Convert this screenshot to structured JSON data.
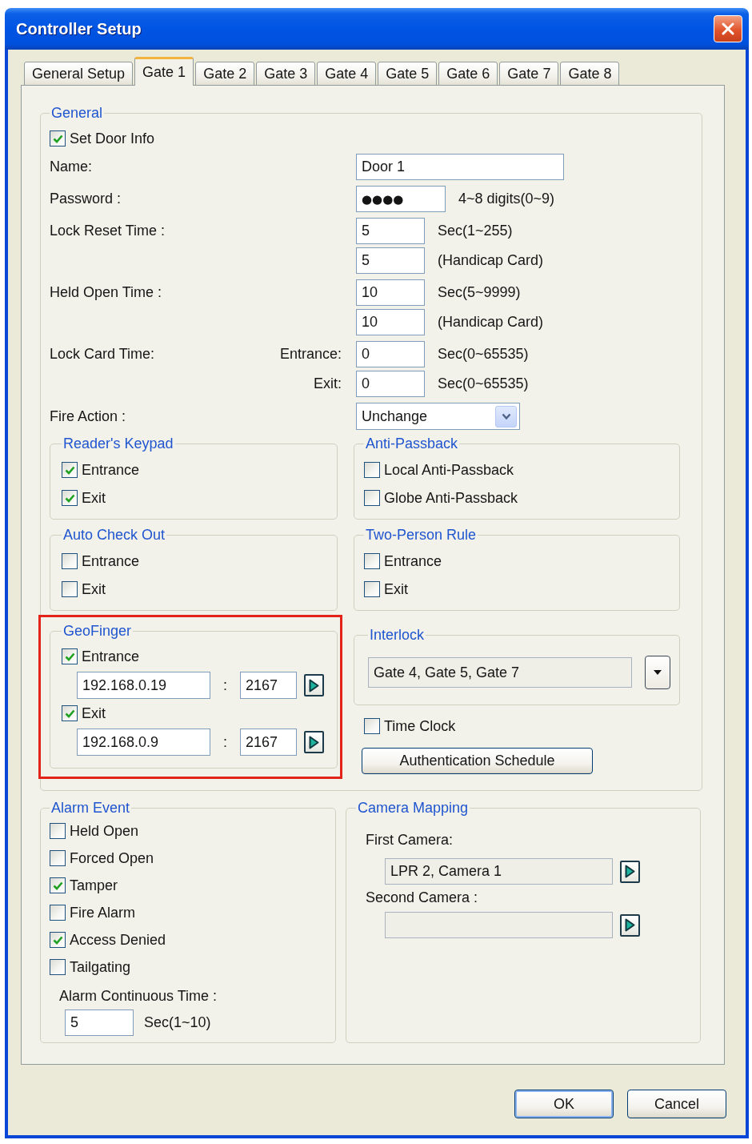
{
  "window": {
    "title": "Controller Setup"
  },
  "tabs": [
    {
      "label": "General Setup",
      "selected": false
    },
    {
      "label": "Gate 1",
      "selected": true
    },
    {
      "label": "Gate 2",
      "selected": false
    },
    {
      "label": "Gate 3",
      "selected": false
    },
    {
      "label": "Gate 4",
      "selected": false
    },
    {
      "label": "Gate 5",
      "selected": false
    },
    {
      "label": "Gate 6",
      "selected": false
    },
    {
      "label": "Gate 7",
      "selected": false
    },
    {
      "label": "Gate 8",
      "selected": false
    }
  ],
  "general": {
    "legend": "General",
    "set_door_info": {
      "label": "Set Door Info",
      "checked": true
    },
    "fields": [
      {
        "kind": "text",
        "label": "Name:",
        "lines": [
          {
            "value": "Door 1"
          }
        ]
      },
      {
        "kind": "password",
        "label": "Password :",
        "lines": [
          {
            "value": "●●●●",
            "hint": "4~8 digits(0~9)"
          }
        ]
      },
      {
        "kind": "number",
        "label": "Lock Reset Time :",
        "lines": [
          {
            "value": "5",
            "hint": "Sec(1~255)"
          },
          {
            "value": "5",
            "hint": "(Handicap Card)"
          }
        ]
      },
      {
        "kind": "number",
        "label": "Held Open Time :",
        "lines": [
          {
            "value": "10",
            "hint": "Sec(5~9999)"
          },
          {
            "value": "10",
            "hint": "(Handicap Card)"
          }
        ]
      },
      {
        "kind": "number",
        "label": "Lock Card Time:",
        "lines": [
          {
            "sublabel": "Entrance:",
            "value": "0",
            "hint": "Sec(0~65535)"
          },
          {
            "sublabel": "Exit:",
            "value": "0",
            "hint": "Sec(0~65535)"
          }
        ]
      },
      {
        "kind": "select",
        "label": "Fire Action :",
        "lines": [
          {
            "value": "Unchange"
          }
        ]
      }
    ],
    "sections": [
      {
        "kind": "checks",
        "legend": "Reader's Keypad",
        "highlighted": false,
        "items": [
          {
            "label": "Entrance",
            "checked": true
          },
          {
            "label": "Exit",
            "checked": true
          }
        ]
      },
      {
        "kind": "checks",
        "legend": "Anti-Passback",
        "highlighted": false,
        "items": [
          {
            "label": "Local Anti-Passback",
            "checked": false
          },
          {
            "label": "Globe Anti-Passback",
            "checked": false
          }
        ]
      },
      {
        "kind": "checks",
        "legend": "Auto Check Out",
        "highlighted": false,
        "items": [
          {
            "label": "Entrance",
            "checked": false
          },
          {
            "label": "Exit",
            "checked": false
          }
        ]
      },
      {
        "kind": "checks",
        "legend": "Two-Person Rule",
        "highlighted": false,
        "items": [
          {
            "label": "Entrance",
            "checked": false
          },
          {
            "label": "Exit",
            "checked": false
          }
        ]
      },
      {
        "kind": "endpoints",
        "legend": "GeoFinger",
        "highlighted": true,
        "items": [
          {
            "label": "Entrance",
            "checked": true,
            "ip": "192.168.0.19",
            "separator": ":",
            "port": "2167"
          },
          {
            "label": "Exit",
            "checked": true,
            "ip": "192.168.0.9",
            "separator": ":",
            "port": "2167"
          }
        ]
      },
      {
        "kind": "interlock",
        "legend": "Interlock",
        "highlighted": false,
        "value": "Gate 4, Gate 5, Gate 7",
        "time_clock": {
          "label": "Time Clock",
          "checked": false
        },
        "button": "Authentication Schedule"
      }
    ]
  },
  "alarm_event": {
    "legend": "Alarm Event",
    "items": [
      {
        "label": "Held Open",
        "checked": false
      },
      {
        "label": "Forced Open",
        "checked": false
      },
      {
        "label": "Tamper",
        "checked": true
      },
      {
        "label": "Fire Alarm",
        "checked": false
      },
      {
        "label": "Access Denied",
        "checked": true
      },
      {
        "label": "Tailgating",
        "checked": false
      }
    ],
    "duration": {
      "label": "Alarm Continuous Time :",
      "value": "5",
      "hint": "Sec(1~10)"
    }
  },
  "camera_mapping": {
    "legend": "Camera Mapping",
    "cameras": [
      {
        "label": "First Camera:",
        "value": "LPR 2, Camera 1"
      },
      {
        "label": "Second Camera :"
      }
    ]
  },
  "buttons": [
    {
      "label": "OK",
      "default": true
    },
    {
      "label": "Cancel",
      "default": false
    }
  ]
}
